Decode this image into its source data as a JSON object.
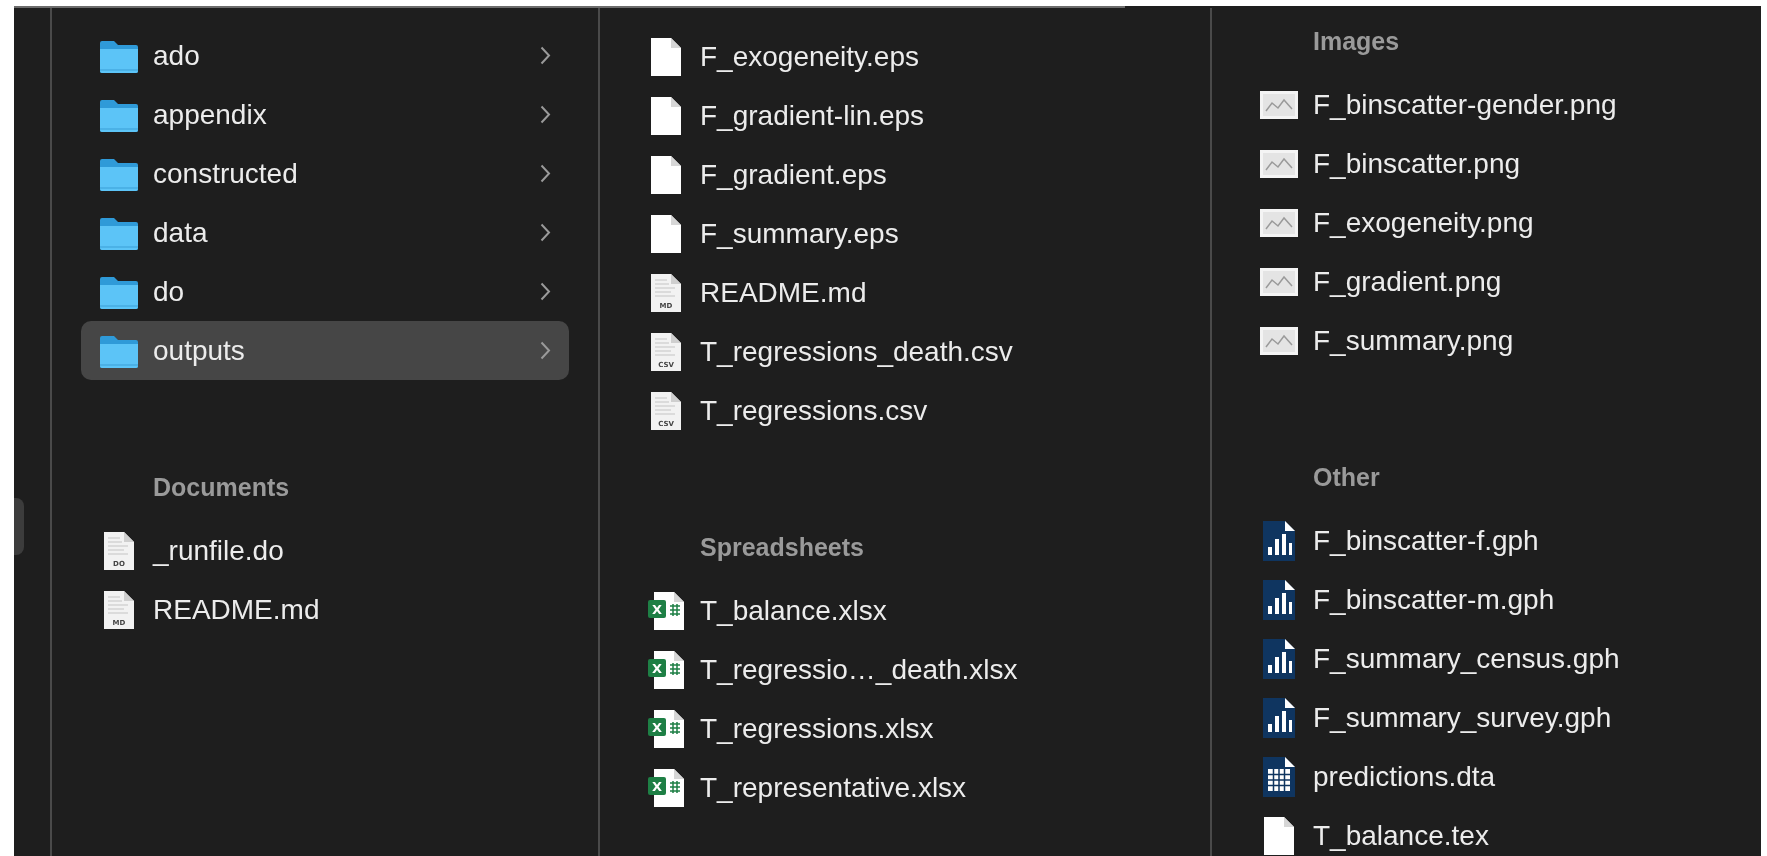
{
  "columns": [
    {
      "groups": [
        {
          "items": [
            {
              "name": "ado",
              "kind": "folder",
              "selected": false
            },
            {
              "name": "appendix",
              "kind": "folder",
              "selected": false
            },
            {
              "name": "constructed",
              "kind": "folder",
              "selected": false
            },
            {
              "name": "data",
              "kind": "folder",
              "selected": false
            },
            {
              "name": "do",
              "kind": "folder",
              "selected": false
            },
            {
              "name": "outputs",
              "kind": "folder",
              "selected": true
            }
          ]
        },
        {
          "heading": "Documents",
          "items": [
            {
              "name": "_runfile.do",
              "kind": "labeled",
              "icon_label": "DO",
              "selected": false
            },
            {
              "name": "README.md",
              "kind": "labeled",
              "icon_label": "MD",
              "selected": false
            }
          ]
        }
      ]
    },
    {
      "groups": [
        {
          "items": [
            {
              "name": "F_exogeneity.eps",
              "kind": "blank",
              "selected": false
            },
            {
              "name": "F_gradient-lin.eps",
              "kind": "blank",
              "selected": false
            },
            {
              "name": "F_gradient.eps",
              "kind": "blank",
              "selected": false
            },
            {
              "name": "F_summary.eps",
              "kind": "blank",
              "selected": false
            },
            {
              "name": "README.md",
              "kind": "labeled",
              "icon_label": "MD",
              "selected": false
            },
            {
              "name": "T_regressions_death.csv",
              "kind": "labeled",
              "icon_label": "CSV",
              "selected": false
            },
            {
              "name": "T_regressions.csv",
              "kind": "labeled",
              "icon_label": "CSV",
              "selected": false
            }
          ]
        },
        {
          "heading": "Spreadsheets",
          "items": [
            {
              "name": "T_balance.xlsx",
              "kind": "xlsx",
              "icon_label": "X",
              "selected": false
            },
            {
              "name": "T_regressio…_death.xlsx",
              "kind": "xlsx",
              "icon_label": "X",
              "selected": false
            },
            {
              "name": "T_regressions.xlsx",
              "kind": "xlsx",
              "icon_label": "X",
              "selected": false
            },
            {
              "name": "T_representative.xlsx",
              "kind": "xlsx",
              "icon_label": "X",
              "selected": false
            }
          ]
        }
      ]
    },
    {
      "groups": [
        {
          "heading": "Images",
          "items": [
            {
              "name": "F_binscatter-gender.png",
              "kind": "thumbnail",
              "selected": false
            },
            {
              "name": "F_binscatter.png",
              "kind": "thumbnail",
              "selected": false
            },
            {
              "name": "F_exogeneity.png",
              "kind": "thumbnail",
              "selected": false
            },
            {
              "name": "F_gradient.png",
              "kind": "thumbnail",
              "selected": false
            },
            {
              "name": "F_summary.png",
              "kind": "thumbnail",
              "selected": false
            }
          ]
        },
        {
          "heading": "Other",
          "items": [
            {
              "name": "F_binscatter-f.gph",
              "kind": "graph",
              "selected": false
            },
            {
              "name": "F_binscatter-m.gph",
              "kind": "graph",
              "selected": false
            },
            {
              "name": "F_summary_census.gph",
              "kind": "graph",
              "selected": false
            },
            {
              "name": "F_summary_survey.gph",
              "kind": "graph",
              "selected": false
            },
            {
              "name": "predictions.dta",
              "kind": "table",
              "selected": false
            },
            {
              "name": "T_balance.tex",
              "kind": "blank",
              "selected": false
            }
          ]
        }
      ]
    }
  ]
}
